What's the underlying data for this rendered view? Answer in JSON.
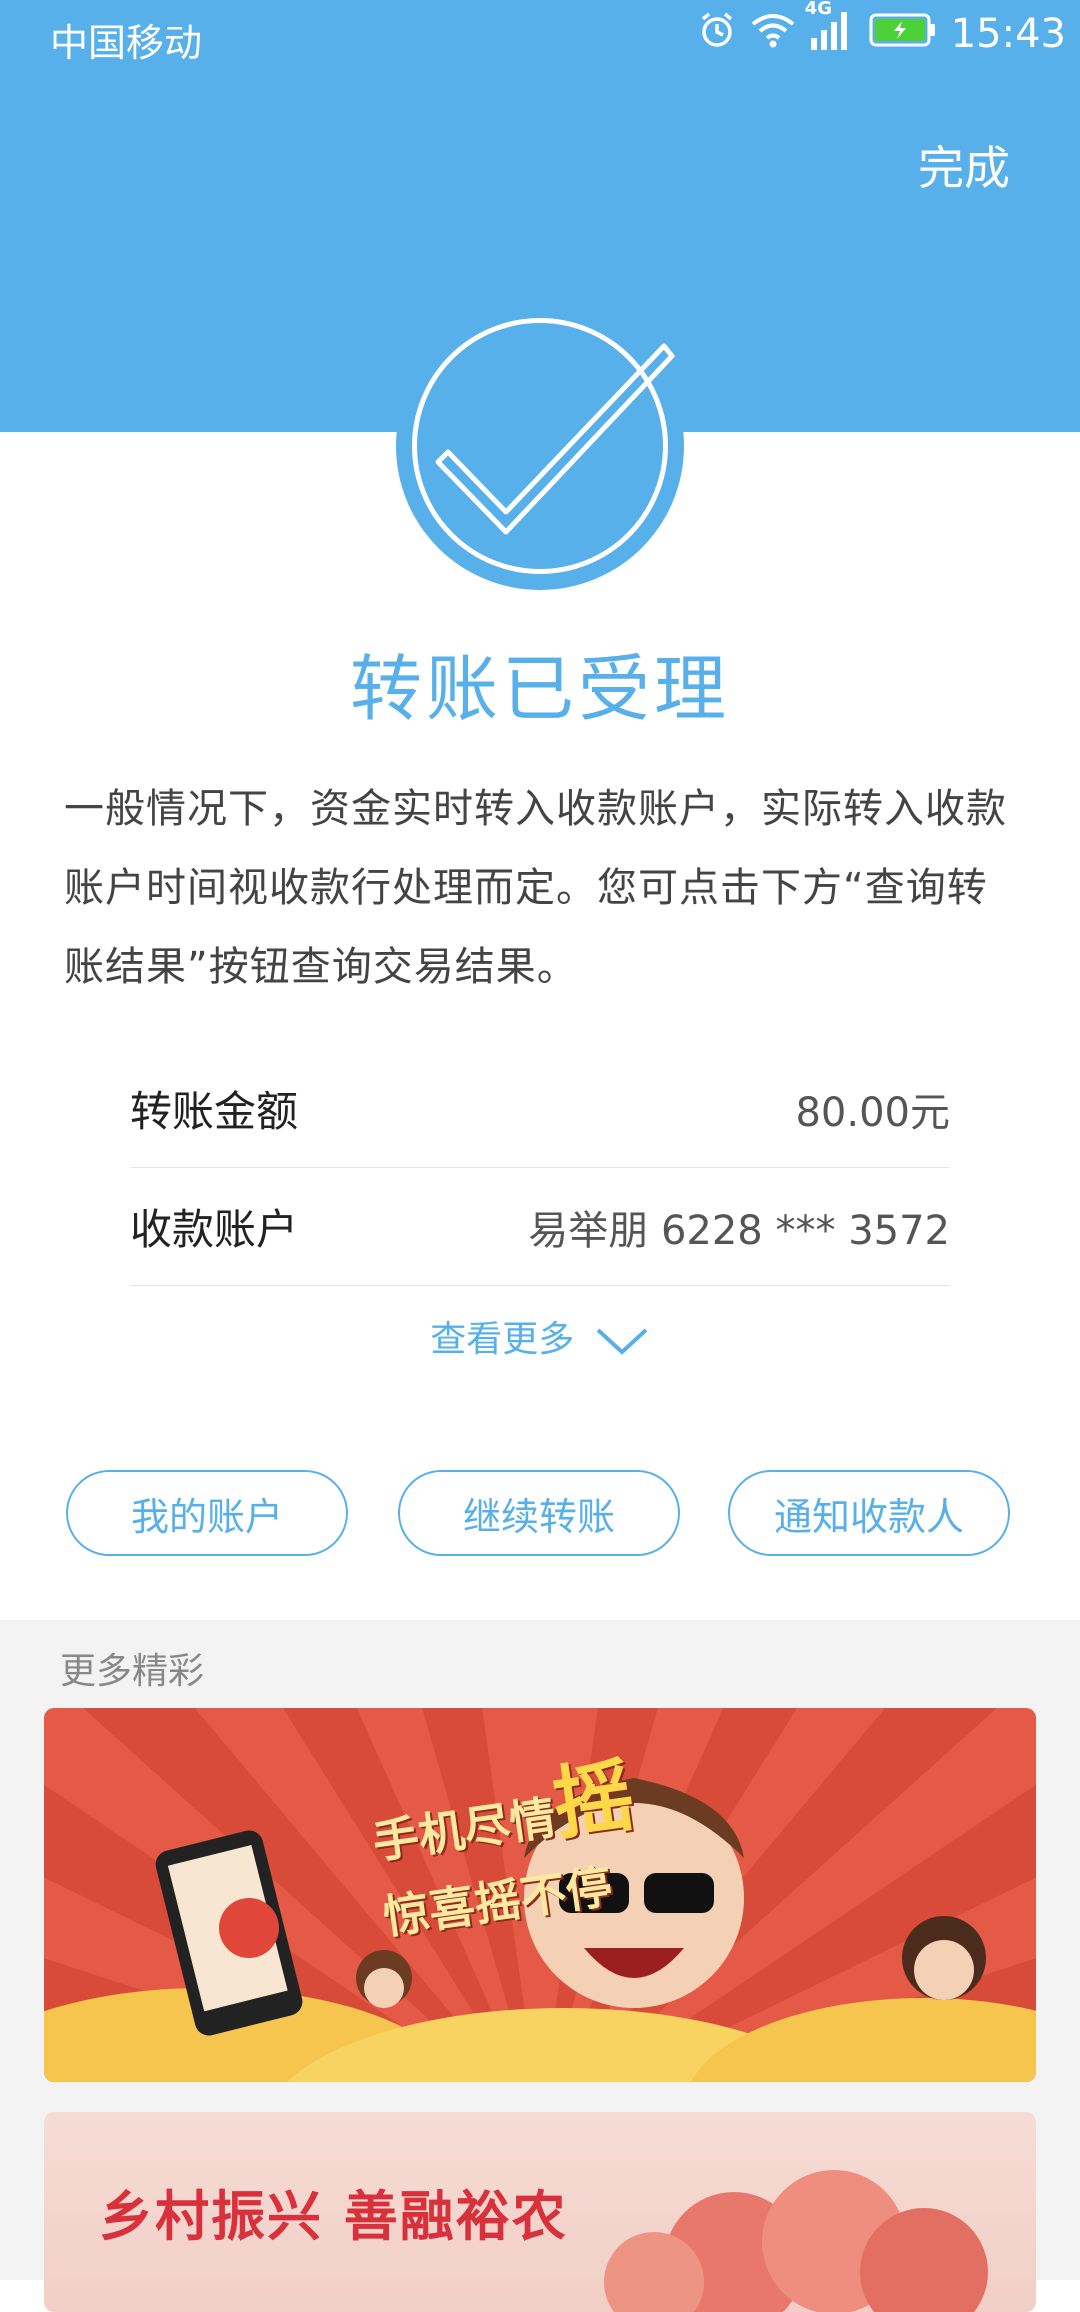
{
  "status_bar": {
    "carrier": "中国移动",
    "network": "4G",
    "time": "15:43"
  },
  "header": {
    "done_label": "完成"
  },
  "result": {
    "title": "转账已受理",
    "description": "一般情况下，资金实时转入收款账户，实际转入收款账户时间视收款行处理而定。您可点击下方“查询转账结果”按钮查询交易结果。"
  },
  "details": [
    {
      "label": "转账金额",
      "value": "80.00元"
    },
    {
      "label": "收款账户",
      "value": "易举朋 6228 *** 3572"
    }
  ],
  "more_toggle": "查看更多",
  "actions": [
    {
      "label": "我的账户"
    },
    {
      "label": "继续转账"
    },
    {
      "label": "通知收款人"
    }
  ],
  "promotions": {
    "section_title": "更多精彩",
    "banner1": {
      "line1": "手机尽情",
      "line1_big": "摇",
      "line2": "惊喜摇不停"
    },
    "banner2": {
      "headline": "乡村振兴 善融裕农"
    }
  },
  "colors": {
    "accent": "#58b0ea",
    "battery": "#4cd137",
    "banner1_bg": "#e55a46",
    "banner2_bg": "#f6dcd5"
  }
}
